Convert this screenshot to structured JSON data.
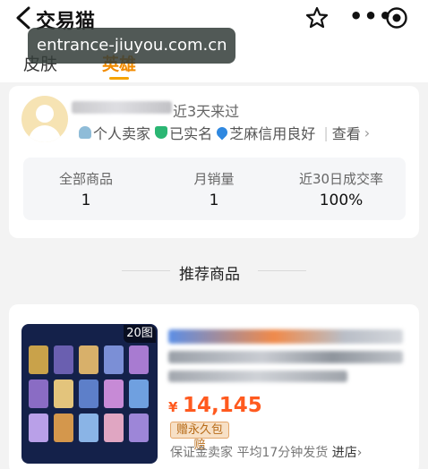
{
  "header": {
    "title": "交易猫",
    "watermark": "entrance-jiuyou.com.cn",
    "icons": [
      "back-arrow-icon",
      "star-icon",
      "more-icon",
      "record-icon"
    ],
    "more_symbol": "•••"
  },
  "tabs": [
    {
      "label": "皮肤",
      "active": false
    },
    {
      "label": "英雄",
      "active": true
    }
  ],
  "seller": {
    "last_visit": "近3天来过",
    "badges": [
      {
        "icon": "person-icon",
        "label": "个人卖家"
      },
      {
        "icon": "verified-shield-icon",
        "label": "已实名"
      },
      {
        "icon": "sesame-credit-icon",
        "label": "芝麻信用良好"
      }
    ],
    "view_label": "查看",
    "chevron": "›",
    "separator": "|",
    "stats": [
      {
        "label": "全部商品",
        "value": "1"
      },
      {
        "label": "月销量",
        "value": "1"
      },
      {
        "label": "近30日成交率",
        "value": "100%"
      }
    ]
  },
  "recommend": {
    "title": "推荐商品"
  },
  "product": {
    "image_count": "20图",
    "currency": "¥",
    "price": "14,145",
    "tag": "赠永久包赔",
    "meta_text": "保证金卖家 平均17分钟发货",
    "shop_link": "进店",
    "chevron": "›"
  },
  "colors": {
    "accent": "#f28b00",
    "price": "#ff5a1f",
    "background": "#f3f3f3"
  }
}
